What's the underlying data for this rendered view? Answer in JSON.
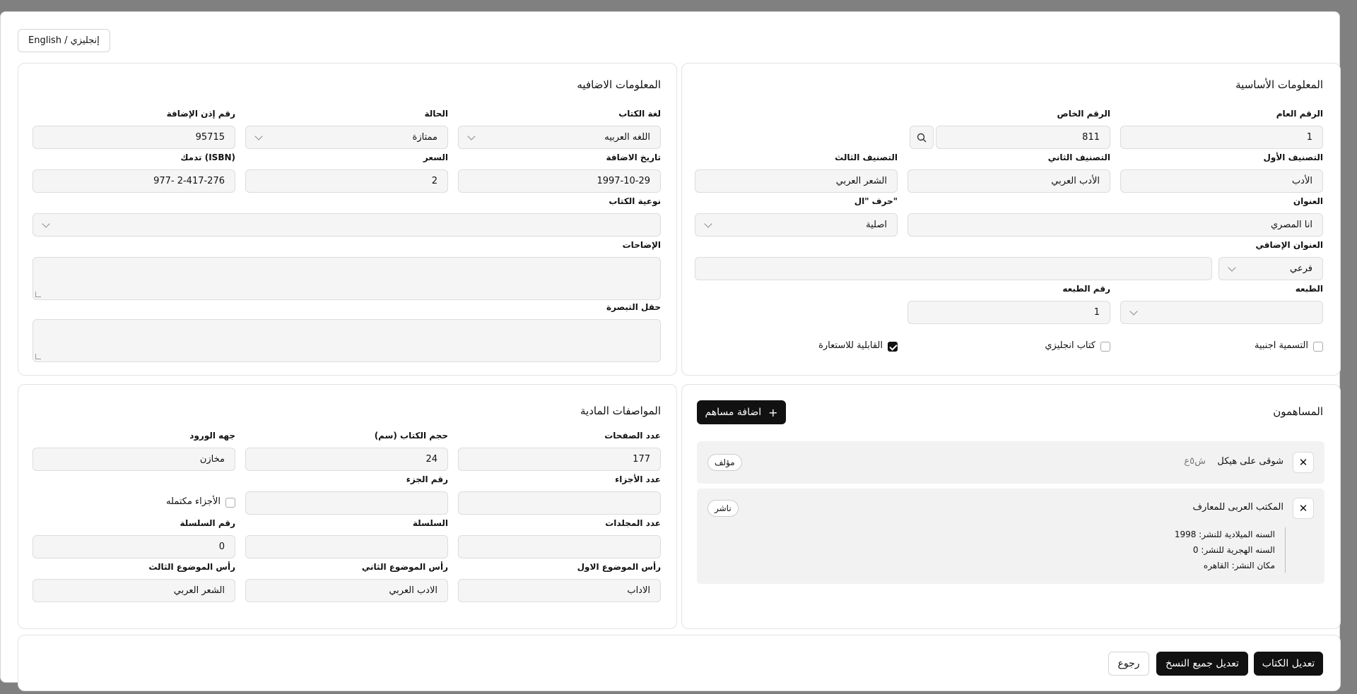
{
  "lang_button": "English / إنجليزي",
  "basic": {
    "title": "المعلومات الأساسية",
    "general_number": {
      "label": "الرقم العام",
      "value": "1"
    },
    "special_number": {
      "label": "الرقم الخاص",
      "value": "811"
    },
    "class1": {
      "label": "التصنيف الأول",
      "value": "الأدب"
    },
    "class2": {
      "label": "التصنيف الثاني",
      "value": "الأدب العربي"
    },
    "class3": {
      "label": "التصنيف الثالث",
      "value": "الشعر العربي"
    },
    "title_field": {
      "label": "العنوان",
      "value": "انا المصري"
    },
    "al_letter": {
      "label": "حرف \"ال\"",
      "value": "اصلية"
    },
    "extra_title": {
      "label": "العنوان الإضافي",
      "type_value": "فرعي",
      "value": ""
    },
    "edition": {
      "label": "الطبعه",
      "value": ""
    },
    "edition_number": {
      "label": "رقم الطبعه",
      "value": "1"
    },
    "foreign_name": {
      "label": "التسمية اجنبية",
      "checked": false
    },
    "english_book": {
      "label": "كتاب انجليزي",
      "checked": false
    },
    "borrowable": {
      "label": "القابلية للاستعارة",
      "checked": true
    }
  },
  "extra": {
    "title": "المعلومات الاضافيه",
    "language": {
      "label": "لغة الكتاب",
      "value": "اللغه العربيه"
    },
    "status": {
      "label": "الحالة",
      "value": "ممتازة"
    },
    "addition_permit": {
      "label": "رقم إذن الإضافة",
      "value": "95715"
    },
    "add_date": {
      "label": "تاريخ الاضافة",
      "value": "1997-10-29"
    },
    "price": {
      "label": "السعر",
      "value": "2"
    },
    "isbn": {
      "label": "تدمك (ISBN)",
      "value": "977- 2-417-276"
    },
    "book_type": {
      "label": "نوعية الكتاب",
      "value": ""
    },
    "clarifications": {
      "label": "الإضاحات"
    },
    "insight": {
      "label": "حقل التبصرة"
    }
  },
  "contributors": {
    "title": "المساهمون",
    "add_button": "اضافة مساهم",
    "items": [
      {
        "name": "شوقى على هيكل",
        "code": "ش٥ع",
        "role": "مؤلف"
      },
      {
        "name": "المكتب العربى للمعارف",
        "role": "ناشر",
        "details": [
          "السنه الميلادية للنشر: 1998",
          "السنه الهجرية للنشر: 0",
          "مكان النشر: القاهره"
        ]
      }
    ]
  },
  "physical": {
    "title": "المواصفات المادية",
    "pages": {
      "label": "عدد الصفحات",
      "value": "177"
    },
    "size": {
      "label": "حجم الكتاب (سم)",
      "value": "24"
    },
    "source": {
      "label": "جهه الورود",
      "value": "مخازن"
    },
    "parts_count": {
      "label": "عدد الأجزاء",
      "value": ""
    },
    "part_number": {
      "label": "رقم الجزء",
      "value": ""
    },
    "parts_complete": {
      "label": "الأجزاء مكتمله",
      "checked": false
    },
    "volumes": {
      "label": "عدد المجلدات",
      "value": ""
    },
    "series": {
      "label": "السلسلة",
      "value": ""
    },
    "series_number": {
      "label": "رقم السلسلة",
      "value": "0"
    },
    "subject1": {
      "label": "رأس الموضوع الاول",
      "value": "الاداب"
    },
    "subject2": {
      "label": "رأس الموضوع الثاني",
      "value": "الادب العربي"
    },
    "subject3": {
      "label": "رأس الموضوع الثالث",
      "value": "الشعر العربي"
    }
  },
  "footer": {
    "edit_book": "تعديل الكتاب",
    "edit_all_copies": "تعديل جميع النسخ",
    "back": "رجوع"
  }
}
